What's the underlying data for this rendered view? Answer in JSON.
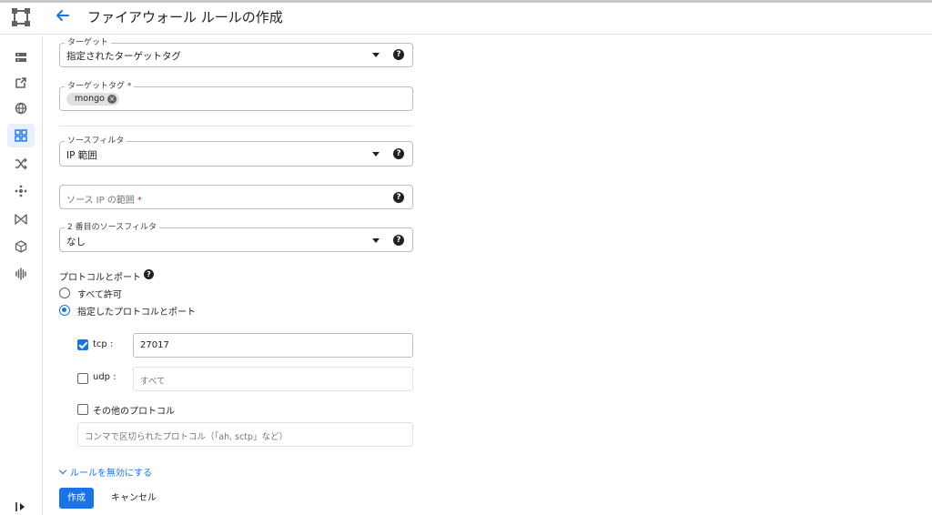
{
  "header": {
    "title": "ファイアウォール ルールの作成",
    "back_icon": "arrow-back-icon",
    "logo_icon": "vpc-network-logo-icon"
  },
  "rail": {
    "items": [
      {
        "icon": "server-icon",
        "active": false
      },
      {
        "icon": "external-link-icon",
        "active": false
      },
      {
        "icon": "globe-icon",
        "active": false
      },
      {
        "icon": "firewall-grid-icon",
        "active": true
      },
      {
        "icon": "shuffle-icon",
        "active": false
      },
      {
        "icon": "hub-icon",
        "active": false
      },
      {
        "icon": "bowtie-icon",
        "active": false
      },
      {
        "icon": "cube-network-icon",
        "active": false
      },
      {
        "icon": "waveform-icon",
        "active": false
      }
    ],
    "collapse_icon": "collapse-rail-icon"
  },
  "form": {
    "target": {
      "label": "ターゲット",
      "value": "指定されたターゲットタグ"
    },
    "target_tags": {
      "label": "ターゲットタグ",
      "required_mark": "*",
      "chips": [
        {
          "label": "mongo"
        }
      ]
    },
    "source_filter": {
      "label": "ソースフィルタ",
      "value": "IP 範囲"
    },
    "source_ip_ranges": {
      "placeholder": "ソース IP の範囲",
      "required_mark": "*",
      "value": ""
    },
    "second_source_filter": {
      "label": "2 番目のソースフィルタ",
      "value": "なし"
    },
    "protocols": {
      "title": "プロトコルとポート",
      "options": [
        {
          "label": "すべて許可",
          "selected": false
        },
        {
          "label": "指定したプロトコルとポート",
          "selected": true
        }
      ],
      "tcp": {
        "label": "tcp :",
        "checked": true,
        "value": "27017"
      },
      "udp": {
        "label": "udp :",
        "checked": false,
        "placeholder": "すべて"
      },
      "other": {
        "label": "その他のプロトコル",
        "checked": false,
        "placeholder": "コンマで区切られたプロトコル（「ah, sctp」など）"
      }
    },
    "disable_rule_link": "ルールを無効にする",
    "create_button": "作成",
    "cancel_button": "キャンセル"
  },
  "colors": {
    "accent": "#1a73e8",
    "active_rail_bg": "#e8f0fe",
    "border": "#bdbdbd"
  }
}
